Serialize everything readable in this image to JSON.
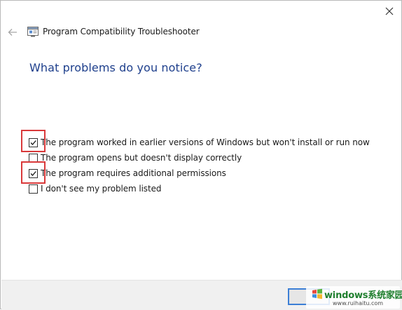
{
  "window": {
    "title": "Program Compatibility Troubleshooter"
  },
  "icons": {
    "close": "close-icon",
    "back": "back-arrow-icon",
    "app": "troubleshooter-icon"
  },
  "page": {
    "heading": "What problems do you notice?"
  },
  "options": [
    {
      "label": "The program worked in earlier versions of Windows but won't install or run now",
      "checked": true
    },
    {
      "label": "The program opens but doesn't display correctly",
      "checked": false
    },
    {
      "label": "The program requires additional permissions",
      "checked": true
    },
    {
      "label": "I don't see my problem listed",
      "checked": false
    }
  ],
  "footer": {
    "next_button": ""
  },
  "watermark": {
    "brand": "windows系统家园",
    "url": "www.ruihaitu.com"
  },
  "colors": {
    "heading": "#1e3f8c",
    "highlight": "#d9393a",
    "button_focus": "#3c7fd6"
  }
}
